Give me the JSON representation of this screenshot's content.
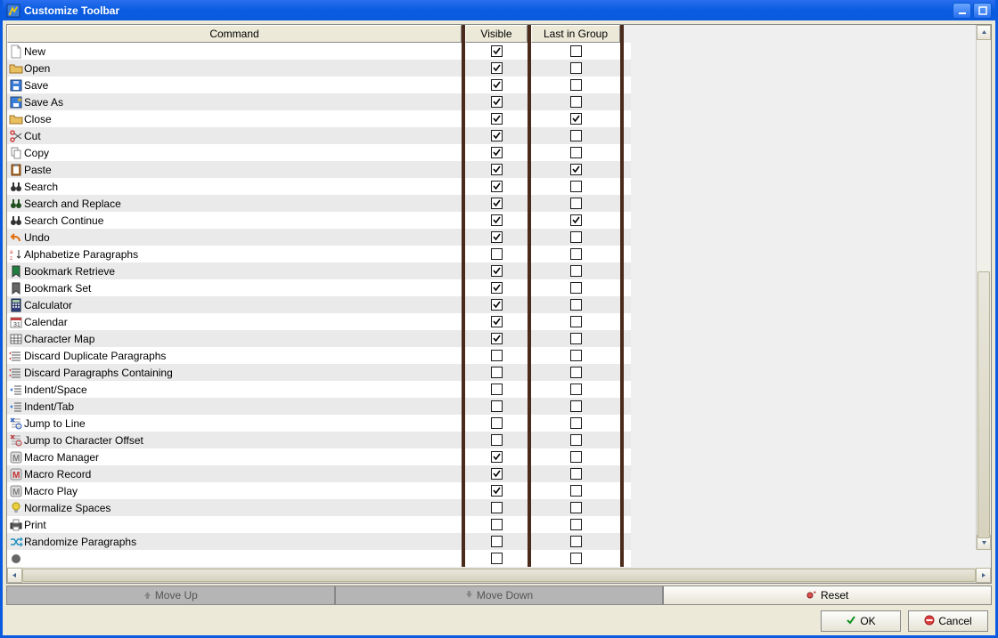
{
  "window": {
    "title": "Customize Toolbar"
  },
  "headers": {
    "command": "Command",
    "visible": "Visible",
    "last_in_group": "Last in Group"
  },
  "rows": [
    {
      "label": "New",
      "icon": "file",
      "color": "#dddddd",
      "visible": true,
      "last": false
    },
    {
      "label": "Open",
      "icon": "folder",
      "color": "#e8c060",
      "visible": true,
      "last": false
    },
    {
      "label": "Save",
      "icon": "disk",
      "color": "#3a7edc",
      "visible": true,
      "last": false
    },
    {
      "label": "Save As",
      "icon": "disk-star",
      "color": "#d0b040",
      "visible": true,
      "last": false
    },
    {
      "label": "Close",
      "icon": "folder",
      "color": "#e8c060",
      "visible": true,
      "last": true
    },
    {
      "label": "Cut",
      "icon": "scissors",
      "color": "#d04040",
      "visible": true,
      "last": false
    },
    {
      "label": "Copy",
      "icon": "copy",
      "color": "#999999",
      "visible": true,
      "last": false
    },
    {
      "label": "Paste",
      "icon": "clipboard",
      "color": "#b07030",
      "visible": true,
      "last": true
    },
    {
      "label": "Search",
      "icon": "binoculars",
      "color": "#333333",
      "visible": true,
      "last": false
    },
    {
      "label": "Search and Replace",
      "icon": "binoculars",
      "color": "#205020",
      "visible": true,
      "last": false
    },
    {
      "label": "Search Continue",
      "icon": "binoculars",
      "color": "#333333",
      "visible": true,
      "last": true
    },
    {
      "label": "Undo",
      "icon": "undo",
      "color": "#e07010",
      "visible": true,
      "last": false
    },
    {
      "label": "Alphabetize Paragraphs",
      "icon": "sort",
      "color": "#d04040",
      "visible": false,
      "last": false
    },
    {
      "label": "Bookmark Retrieve",
      "icon": "bookmark",
      "color": "#208040",
      "visible": true,
      "last": false
    },
    {
      "label": "Bookmark Set",
      "icon": "bookmark",
      "color": "#666666",
      "visible": true,
      "last": false
    },
    {
      "label": "Calculator",
      "icon": "calc",
      "color": "#304080",
      "visible": true,
      "last": false
    },
    {
      "label": "Calendar",
      "icon": "calendar",
      "color": "#ffffff",
      "visible": true,
      "last": false
    },
    {
      "label": "Character Map",
      "icon": "grid",
      "color": "#777777",
      "visible": true,
      "last": false
    },
    {
      "label": "Discard Duplicate Paragraphs",
      "icon": "lines",
      "color": "#cc3333",
      "visible": false,
      "last": false
    },
    {
      "label": "Discard Paragraphs Containing",
      "icon": "lines",
      "color": "#cc3333",
      "visible": false,
      "last": false
    },
    {
      "label": "Indent/Space",
      "icon": "indent",
      "color": "#3a7edc",
      "visible": false,
      "last": false
    },
    {
      "label": "Indent/Tab",
      "icon": "indent",
      "color": "#3a7edc",
      "visible": false,
      "last": false
    },
    {
      "label": "Jump to Line",
      "icon": "jump",
      "color": "#3060c0",
      "visible": false,
      "last": false
    },
    {
      "label": "Jump to Character Offset",
      "icon": "jump",
      "color": "#c04040",
      "visible": false,
      "last": false
    },
    {
      "label": "Macro Manager",
      "icon": "macro",
      "color": "#808080",
      "visible": true,
      "last": false
    },
    {
      "label": "Macro Record",
      "icon": "macro",
      "color": "#c03030",
      "visible": true,
      "last": false
    },
    {
      "label": "Macro Play",
      "icon": "macro",
      "color": "#808080",
      "visible": true,
      "last": false
    },
    {
      "label": "Normalize Spaces",
      "icon": "bulb",
      "color": "#e8d040",
      "visible": false,
      "last": false
    },
    {
      "label": "Print",
      "icon": "printer",
      "color": "#555555",
      "visible": false,
      "last": false
    },
    {
      "label": "Randomize Paragraphs",
      "icon": "random",
      "color": "#2090c0",
      "visible": false,
      "last": false
    },
    {
      "label": "",
      "icon": "generic",
      "color": "#666666",
      "visible": false,
      "last": false
    }
  ],
  "buttons": {
    "move_up": "Move Up",
    "move_down": "Move Down",
    "reset": "Reset",
    "ok": "OK",
    "cancel": "Cancel"
  }
}
